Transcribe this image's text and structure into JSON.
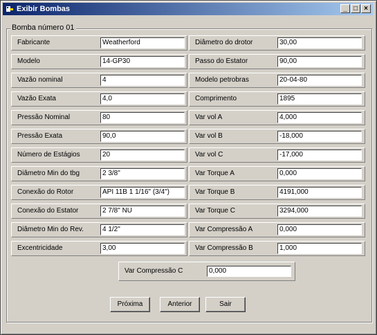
{
  "window": {
    "title": "Exibir Bombas",
    "minimize": "_",
    "maximize": "□",
    "close": "×"
  },
  "group_title": "Bomba número 01",
  "left_fields": [
    {
      "label": "Fabricante",
      "value": "Weatherford"
    },
    {
      "label": "Modelo",
      "value": "14-GP30"
    },
    {
      "label": "Vazão nominal",
      "value": "4"
    },
    {
      "label": "Vazão Exata",
      "value": "4,0"
    },
    {
      "label": "Pressão Nominal",
      "value": "80"
    },
    {
      "label": "Pressão Exata",
      "value": "90,0"
    },
    {
      "label": "Número de Estágios",
      "value": "20"
    },
    {
      "label": "Diâmetro Min do tbg",
      "value": "2 3/8\""
    },
    {
      "label": "Conexão do Rotor",
      "value": "API 11B 1 1/16\" (3/4\")"
    },
    {
      "label": "Conexão do Estator",
      "value": "2 7/8\" NU"
    },
    {
      "label": "Diâmetro Min do Rev.",
      "value": "4 1/2\""
    },
    {
      "label": "Excentricidade",
      "value": "3,00"
    }
  ],
  "right_fields": [
    {
      "label": "Diâmetro do drotor",
      "value": "30,00"
    },
    {
      "label": "Passo do Estator",
      "value": "90,00"
    },
    {
      "label": "Modelo petrobras",
      "value": "20-04-80"
    },
    {
      "label": "Comprimento",
      "value": "1895"
    },
    {
      "label": "Var vol A",
      "value": "4,000"
    },
    {
      "label": "Var vol B",
      "value": "-18,000"
    },
    {
      "label": "Var vol C",
      "value": "-17,000"
    },
    {
      "label": "Var Torque A",
      "value": "0,000"
    },
    {
      "label": "Var Torque B",
      "value": "4191,000"
    },
    {
      "label": "Var Torque C",
      "value": "3294,000"
    },
    {
      "label": "Var Compressão A",
      "value": "0,000"
    },
    {
      "label": "Var Compressão B",
      "value": "1,000"
    }
  ],
  "center_field": {
    "label": "Var Compressão C",
    "value": "0,000"
  },
  "buttons": {
    "next": "Próxima",
    "previous": "Anterior",
    "exit": "Sair"
  }
}
